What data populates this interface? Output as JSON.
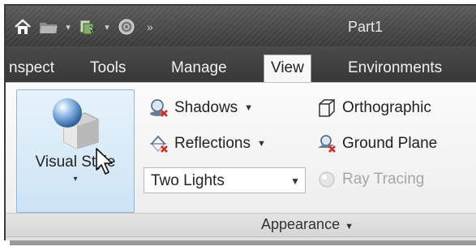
{
  "window": {
    "title": "Part1"
  },
  "quick_access": {
    "items": [
      {
        "name": "home",
        "icon": "home-icon"
      },
      {
        "name": "open",
        "icon": "open-folder-icon"
      },
      {
        "name": "new-part",
        "icon": "new-part-icon"
      },
      {
        "name": "appearance",
        "icon": "sphere-icon"
      }
    ],
    "overflow": "»"
  },
  "ribbon": {
    "tabs": [
      {
        "label": "nspect",
        "active": false
      },
      {
        "label": "Tools",
        "active": false
      },
      {
        "label": "Manage",
        "active": false
      },
      {
        "label": "View",
        "active": true
      },
      {
        "label": "Environments",
        "active": false
      }
    ],
    "panel": {
      "visual_style": {
        "label": "Visual Style",
        "caret": "▾"
      },
      "shadows": {
        "label": "Shadows",
        "icon": "shadows-icon"
      },
      "reflections": {
        "label": "Reflections",
        "icon": "reflections-icon"
      },
      "lighting": {
        "value": "Two Lights",
        "arrow": "▼"
      },
      "orthographic": {
        "label": "Orthographic",
        "icon": "orthographic-cube-icon"
      },
      "ground_plane": {
        "label": "Ground Plane",
        "icon": "ground-plane-icon"
      },
      "ray_tracing": {
        "label": "Ray Tracing",
        "icon": "ray-tracing-icon",
        "enabled": false
      },
      "group_label": "Appearance",
      "group_arrow": "▼"
    }
  },
  "colors": {
    "titlebar": "#3c3c3c",
    "tab_bar": "#383838",
    "panel_bg": "#f2f2f2",
    "highlight": "#cde4f6",
    "warning_red": "#d9261c"
  }
}
